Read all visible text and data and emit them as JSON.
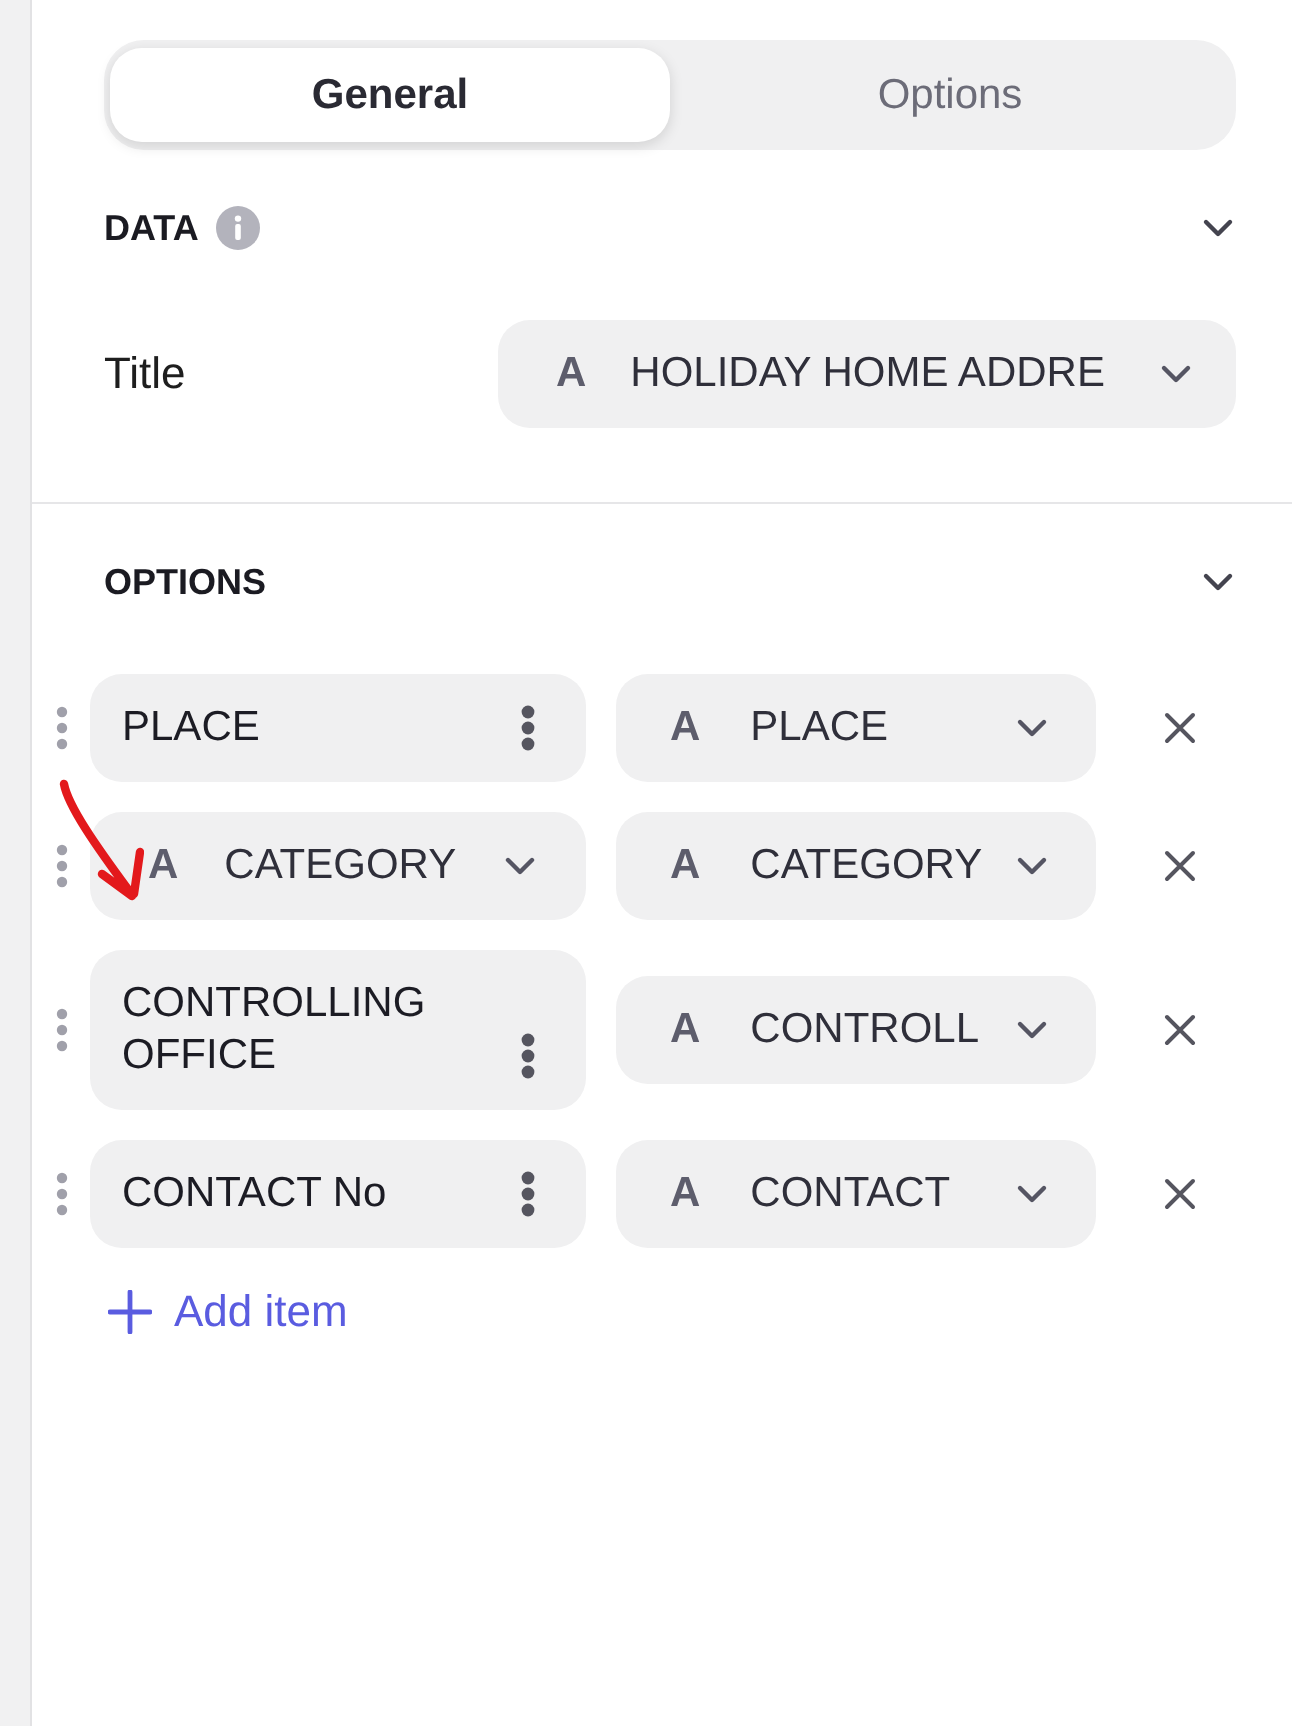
{
  "tabs": [
    {
      "label": "General",
      "selected": true
    },
    {
      "label": "Options",
      "selected": false
    }
  ],
  "data_section": {
    "title": "DATA",
    "info": true,
    "expanded": true,
    "fields": [
      {
        "label": "Title",
        "glyph": "A",
        "value": "HOLIDAY HOME ADDRE"
      }
    ]
  },
  "options_section": {
    "title": "OPTIONS",
    "expanded": true,
    "items": [
      {
        "kind": "text",
        "label": "PLACE",
        "source": {
          "glyph": "A",
          "value": "PLACE"
        }
      },
      {
        "kind": "select",
        "glyph": "A",
        "label": "CATEGORY",
        "source": {
          "glyph": "A",
          "value": "CATEGORY"
        }
      },
      {
        "kind": "text",
        "label": "CONTROLLING OFFICE",
        "source": {
          "glyph": "A",
          "value": "CONTROLL"
        }
      },
      {
        "kind": "text",
        "label": "CONTACT No",
        "source": {
          "glyph": "A",
          "value": "CONTACT"
        }
      }
    ],
    "add_label": "Add item"
  },
  "annotation": {
    "kind": "arrow"
  }
}
